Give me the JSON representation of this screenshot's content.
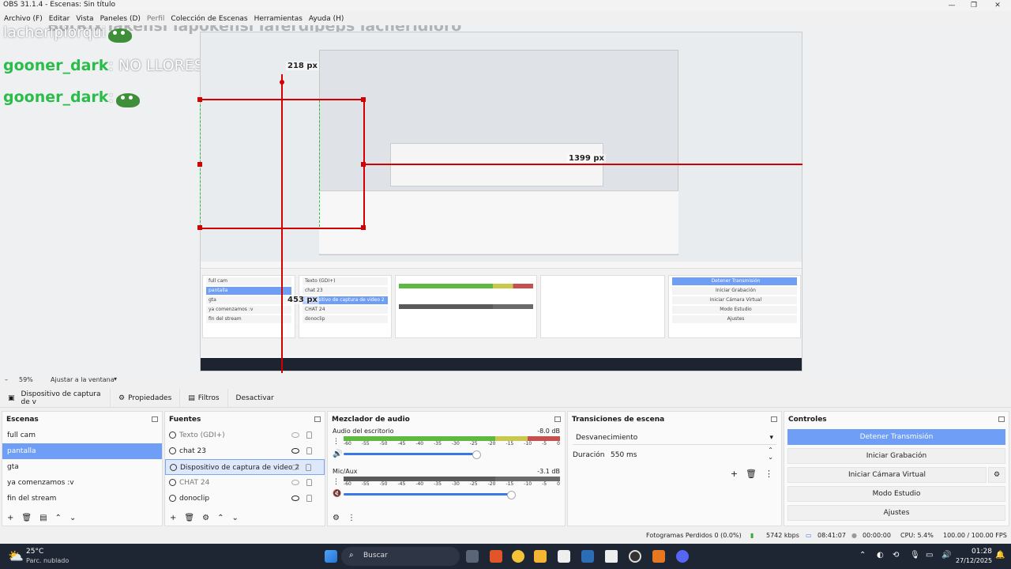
{
  "window": {
    "title": "OBS 31.1.4 - Escenas: Sin título",
    "minimize": "—",
    "maximize": "❐",
    "close": "✕"
  },
  "menu": [
    "Archivo (F)",
    "Editar",
    "Vista",
    "Paneles (D)",
    "Perfil",
    "Colección de Escenas",
    "Herramientas",
    "Ayuda (H)"
  ],
  "overlay": {
    "top_text": "BotRix  lakensi lapokensi laferdipeps lacheridioro",
    "chat": [
      {
        "user": "lacheripiorqui",
        "msg": ""
      },
      {
        "user": "gooner_dark",
        "msg": ": NO LLORES BRO"
      },
      {
        "user": "gooner_dark",
        "msg": ":"
      }
    ],
    "px_labels": [
      "218 px",
      "1399 px",
      "453 px"
    ]
  },
  "zoom": {
    "level": "59%",
    "fit_label": "Ajustar a la ventana"
  },
  "source_toolbar": {
    "source": "Dispositivo de captura de v",
    "properties": "Propiedades",
    "filters": "Filtros",
    "deactivate": "Desactivar"
  },
  "scenes": {
    "title": "Escenas",
    "items": [
      "full cam",
      "pantalla",
      "gta",
      "ya comenzamos :v",
      "fin del stream"
    ],
    "selected": 1
  },
  "sources": {
    "title": "Fuentes",
    "items": [
      {
        "label": "Texto (GDI+)",
        "visible": false,
        "dim": true
      },
      {
        "label": "chat 23",
        "visible": true,
        "dim": false
      },
      {
        "label": "Dispositivo de captura de video 2",
        "visible": false,
        "dim": false,
        "selected": true
      },
      {
        "label": "CHAT 24",
        "visible": false,
        "dim": true
      },
      {
        "label": "donoclip",
        "visible": true,
        "dim": false
      }
    ]
  },
  "mixer": {
    "title": "Mezclador de audio",
    "channels": [
      {
        "name": "Audio del escritorio",
        "db": "-8.0 dB",
        "level": 0.8,
        "volume": 0.62
      },
      {
        "name": "Mic/Aux",
        "db": "-3.1 dB",
        "level": 0.0,
        "volume": 0.78,
        "muted": true
      }
    ],
    "ticks": [
      "-60",
      "-55",
      "-50",
      "-45",
      "-40",
      "-35",
      "-30",
      "-25",
      "-20",
      "-15",
      "-10",
      "-5",
      "0"
    ]
  },
  "transitions": {
    "title": "Transiciones de escena",
    "type": "Desvanecimiento",
    "duration_label": "Duración",
    "duration": "550 ms"
  },
  "controls": {
    "title": "Controles",
    "buttons": [
      "Detener Transmisión",
      "Iniciar Grabación",
      "Iniciar Cámara Virtual",
      "Modo Estudio",
      "Ajustes"
    ]
  },
  "status": {
    "dropped": "Fotogramas Perdidos 0 (0.0%)",
    "bitrate": "5742 kbps",
    "stream_time": "08:41:07",
    "rec_time": "00:00:00",
    "cpu": "CPU: 5.4%",
    "fps": "100.00 / 100.00 FPS"
  },
  "taskbar": {
    "weather_temp": "25°C",
    "weather_desc": "Parc. nublado",
    "search": "Buscar",
    "time": "01:28",
    "date": "27/12/2025"
  }
}
